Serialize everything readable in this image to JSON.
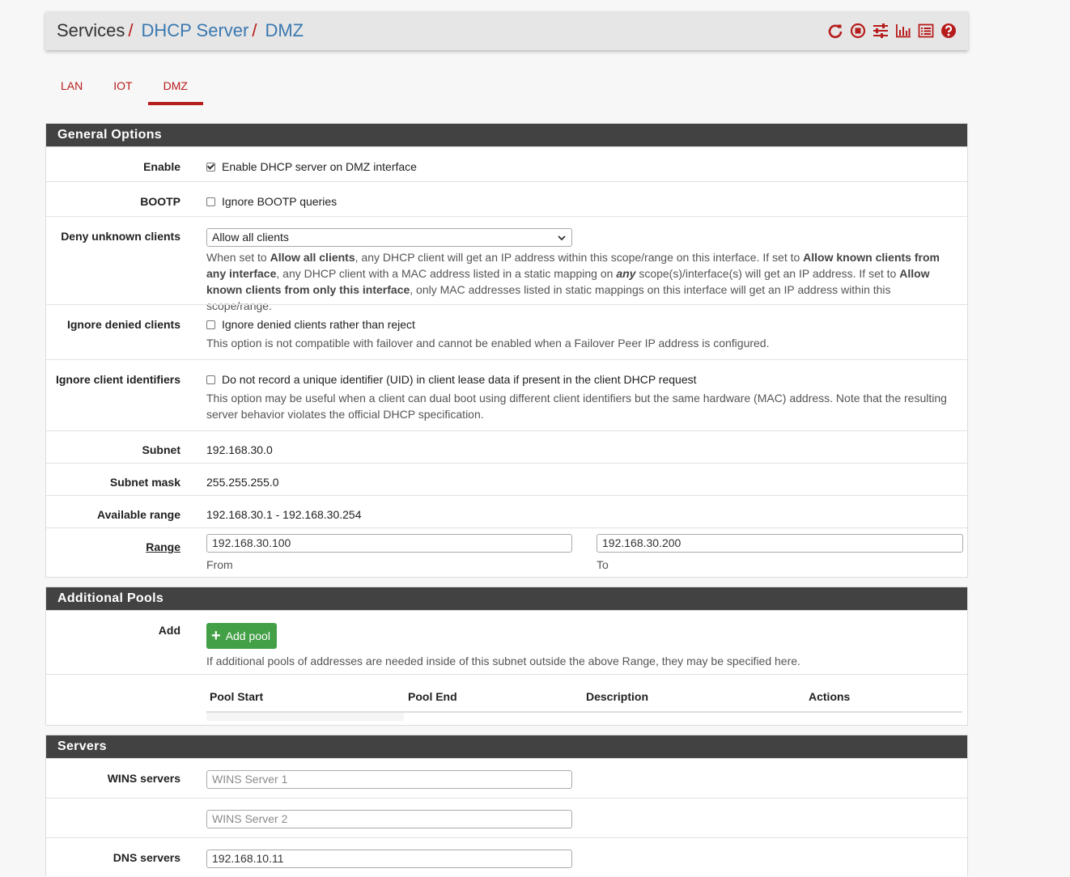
{
  "header": {
    "crumb_0": "Services",
    "crumb_1": "DHCP Server",
    "crumb_2": "DMZ",
    "sep": "/",
    "icons": [
      "reload-icon",
      "stop-icon",
      "sliders-icon",
      "chart-icon",
      "list-icon",
      "help-icon"
    ],
    "icon_color": "#b71c1c"
  },
  "tabs": [
    {
      "label": "LAN"
    },
    {
      "label": "IOT"
    },
    {
      "label": "DMZ",
      "active": true
    }
  ],
  "general": {
    "title": "General Options",
    "enable_label": "Enable",
    "enable_text": "Enable DHCP server on DMZ interface",
    "enable_checked": true,
    "bootp_label": "BOOTP",
    "bootp_text": "Ignore BOOTP queries",
    "bootp_checked": false,
    "deny_label": "Deny unknown clients",
    "deny_value": "Allow all clients",
    "deny_help": {
      "t1": "When set to ",
      "b1": "Allow all clients",
      "t2": ", any DHCP client will get an IP address within this scope/range on this interface. If set to ",
      "b2": "Allow known clients from any interface",
      "t3": ", any DHCP client with a MAC address listed in a static mapping on ",
      "b3": "any",
      "t4": " scope(s)/interface(s) will get an IP address. If set to ",
      "b4": "Allow known clients from only this interface",
      "t5": ", only MAC addresses listed in static mappings on this interface will get an IP address within this scope/range."
    },
    "ignore_denied_label": "Ignore denied clients",
    "ignore_denied_text": "Ignore denied clients rather than reject",
    "ignore_denied_help": "This option is not compatible with failover and cannot be enabled when a Failover Peer IP address is configured.",
    "ignore_uid_label": "Ignore client identifiers",
    "ignore_uid_text": "Do not record a unique identifier (UID) in client lease data if present in the client DHCP request",
    "ignore_uid_help": "This option may be useful when a client can dual boot using different client identifiers but the same hardware (MAC) address. Note that the resulting server behavior violates the official DHCP specification.",
    "subnet_label": "Subnet",
    "subnet_value": "192.168.30.0",
    "mask_label": "Subnet mask",
    "mask_value": "255.255.255.0",
    "avail_label": "Available range",
    "avail_value": "192.168.30.1 - 192.168.30.254",
    "range_label": "Range",
    "range_from": "192.168.30.100",
    "range_to": "192.168.30.200",
    "from_label": "From",
    "to_label": "To"
  },
  "pools": {
    "title": "Additional Pools",
    "add_label": "Add",
    "add_button": "Add pool",
    "add_button_color": "#43a047",
    "help": "If additional pools of addresses are needed inside of this subnet outside the above Range, they may be specified here.",
    "columns": [
      "Pool Start",
      "Pool End",
      "Description",
      "Actions"
    ]
  },
  "servers": {
    "title": "Servers",
    "wins_label": "WINS servers",
    "wins1_placeholder": "WINS Server 1",
    "wins2_placeholder": "WINS Server 2",
    "dns_label": "DNS servers",
    "dns1_value": "192.168.10.11"
  }
}
